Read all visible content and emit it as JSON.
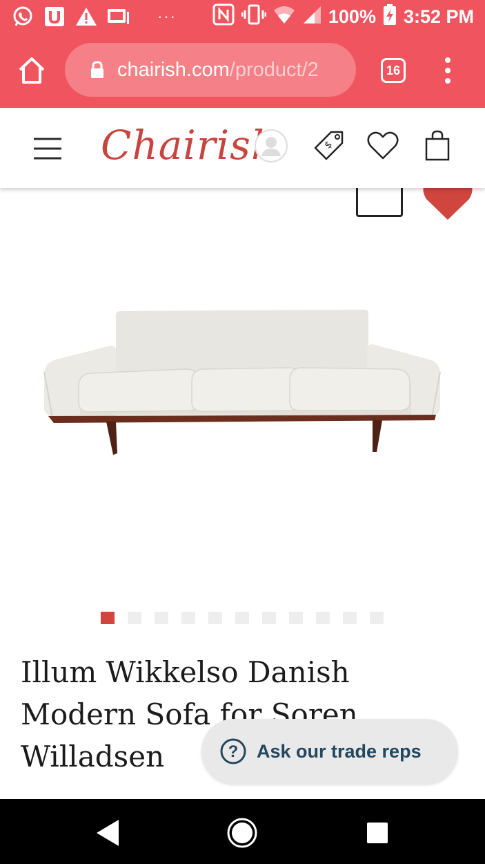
{
  "status_bar": {
    "battery": "100%",
    "time": "3:52 PM",
    "icons": [
      "whatsapp-icon",
      "u-app-icon",
      "warning-icon",
      "gallery-icon",
      "more-dots",
      "nfc-icon",
      "vibrate-icon",
      "wifi-icon",
      "signal-icon",
      "battery-charging-icon"
    ],
    "dots": "···"
  },
  "browser": {
    "url_domain": "chairish.com",
    "url_path": "/product/2",
    "tab_count": "16",
    "theme_color": "#f0555f"
  },
  "site_header": {
    "logo_text": "Chairish",
    "brand_color": "#c8453f",
    "icons": [
      "menu-icon",
      "account-icon",
      "price-tag-icon",
      "heart-icon",
      "shopping-bag-icon"
    ]
  },
  "product": {
    "title": "Illum Wikkelso Danish Modern Sofa for Soren Willadsen",
    "image_count": 11,
    "active_image_index": 1
  },
  "trade_button": {
    "label": "Ask our trade reps"
  },
  "nav_bar": {
    "icons": [
      "back-icon",
      "home-icon",
      "recents-icon"
    ]
  }
}
